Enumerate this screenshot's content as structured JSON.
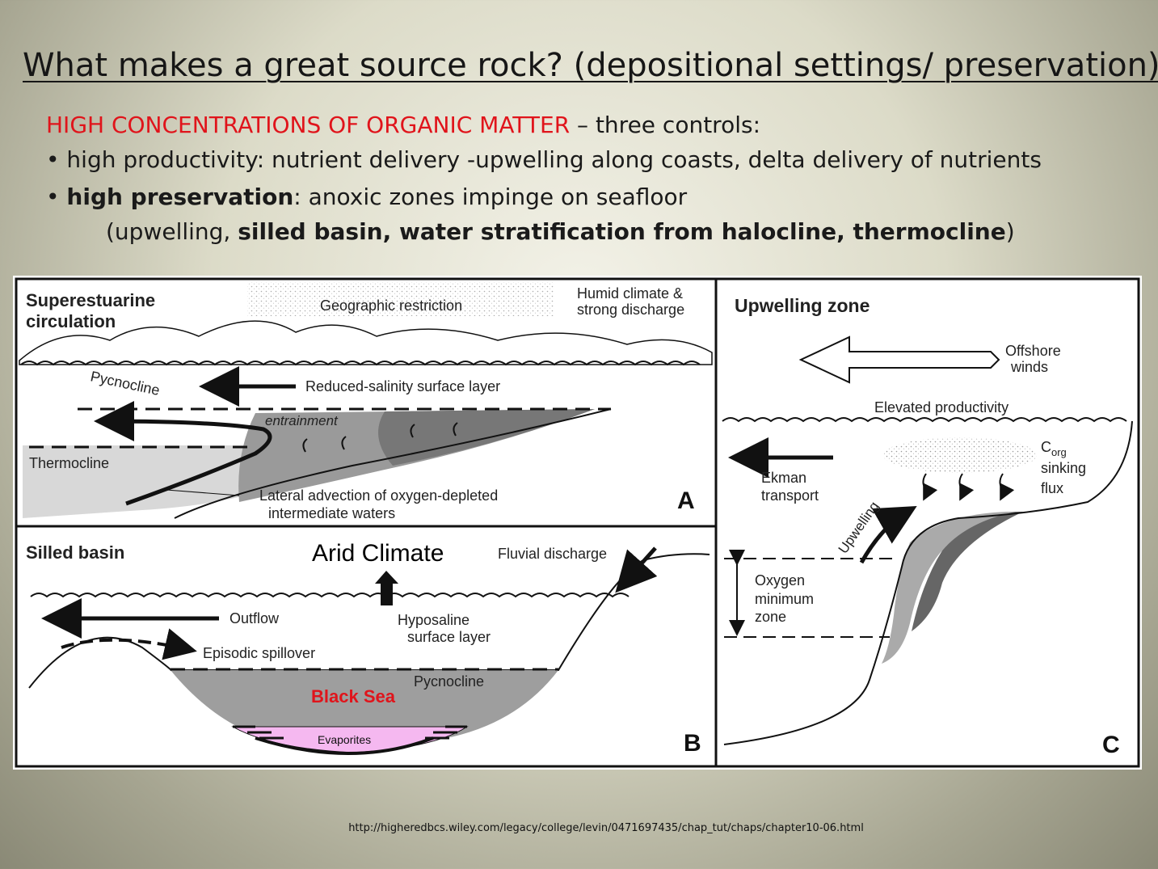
{
  "title": "What makes a great source rock? (depositional settings/ preservation)",
  "intro": {
    "highlight": "HIGH CONCENTRATIONS OF ORGANIC MATTER",
    "rest": " – three controls:"
  },
  "bullets": [
    {
      "marker": "• ",
      "text": "high productivity: nutrient delivery -upwelling along coasts, delta delivery of nutrients"
    },
    {
      "marker": "• ",
      "bold": "high preservation",
      "text": ": anoxic zones impinge on seafloor"
    }
  ],
  "sub_bullet": {
    "open": "(upwelling, ",
    "bold": "silled basin, water stratification from halocline, thermocline",
    "close": ")"
  },
  "panel_a": {
    "title_line1": "Superestuarine",
    "title_line2": "circulation",
    "geographic": "Geographic restriction",
    "humid_line1": "Humid climate &",
    "humid_line2": "strong discharge",
    "pycnocline": "Pycnocline",
    "reduced": "Reduced-salinity surface layer",
    "entrainment": "entrainment",
    "thermocline": "Thermocline",
    "lateral_line1": "Lateral advection of oxygen-depleted",
    "lateral_line2": "intermediate waters",
    "letter": "A"
  },
  "panel_b": {
    "title": "Silled basin",
    "arid": "Arid Climate",
    "fluvial": "Fluvial discharge",
    "outflow": "Outflow",
    "hyposaline_line1": "Hyposaline",
    "hyposaline_line2": "surface layer",
    "spillover": "Episodic spillover",
    "pycnocline": "Pycnocline",
    "black_sea": "Black Sea",
    "evaporites": "Evaporites",
    "letter": "B"
  },
  "panel_c": {
    "title": "Upwelling zone",
    "offshore_line1": "Offshore",
    "offshore_line2": "winds",
    "elevated": "Elevated productivity",
    "corg": "C",
    "corg_sub": "org",
    "sinking": "sinking",
    "flux": "flux",
    "ekman": "Ekman",
    "transport": "transport",
    "upwelling": "Upwelling",
    "oxygen_line1": "Oxygen",
    "oxygen_line2": "minimum",
    "oxygen_line3": "zone",
    "letter": "C"
  },
  "credit": "http://higheredbcs.wiley.com/legacy/college/levin/0471697435/chap_tut/chaps/chapter10-06.html",
  "colors": {
    "highlight": "#e0141b",
    "evaporites_fill": "#f5b8f0"
  }
}
